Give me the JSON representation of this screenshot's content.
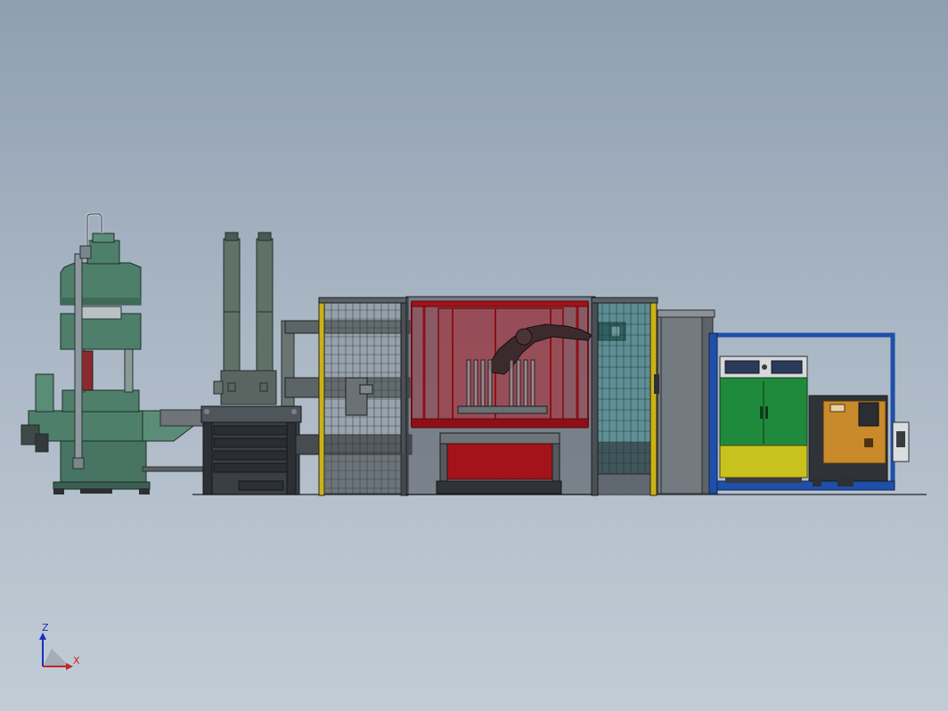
{
  "app": {
    "view": "cad-3d-model-viewport"
  },
  "triad": {
    "z_label": "Z",
    "x_label": "X",
    "z_color": "#1a2fbf",
    "x_color": "#c0262a"
  },
  "colors": {
    "background_top": "#8f9fb2",
    "background_bottom": "#c2ccd6",
    "press_green": "#4e7f6b",
    "enclosure_red": "#b3141b",
    "cabinet_green": "#1f8a3b",
    "cabinet_yellow": "#c9c21e",
    "frame_blue": "#1f4fa8",
    "cabinet_orange": "#c98a2c",
    "safety_yellow": "#c9b21a"
  },
  "parts": [
    {
      "name": "hydraulic-press"
    },
    {
      "name": "twin-cylinder-columns"
    },
    {
      "name": "baler-unit"
    },
    {
      "name": "safety-fence-cell"
    },
    {
      "name": "red-robot-enclosure"
    },
    {
      "name": "teal-panel-cell"
    },
    {
      "name": "grey-electrical-cabinet"
    },
    {
      "name": "blue-frame-skid"
    },
    {
      "name": "green-control-cabinet"
    },
    {
      "name": "orange-control-box"
    }
  ]
}
